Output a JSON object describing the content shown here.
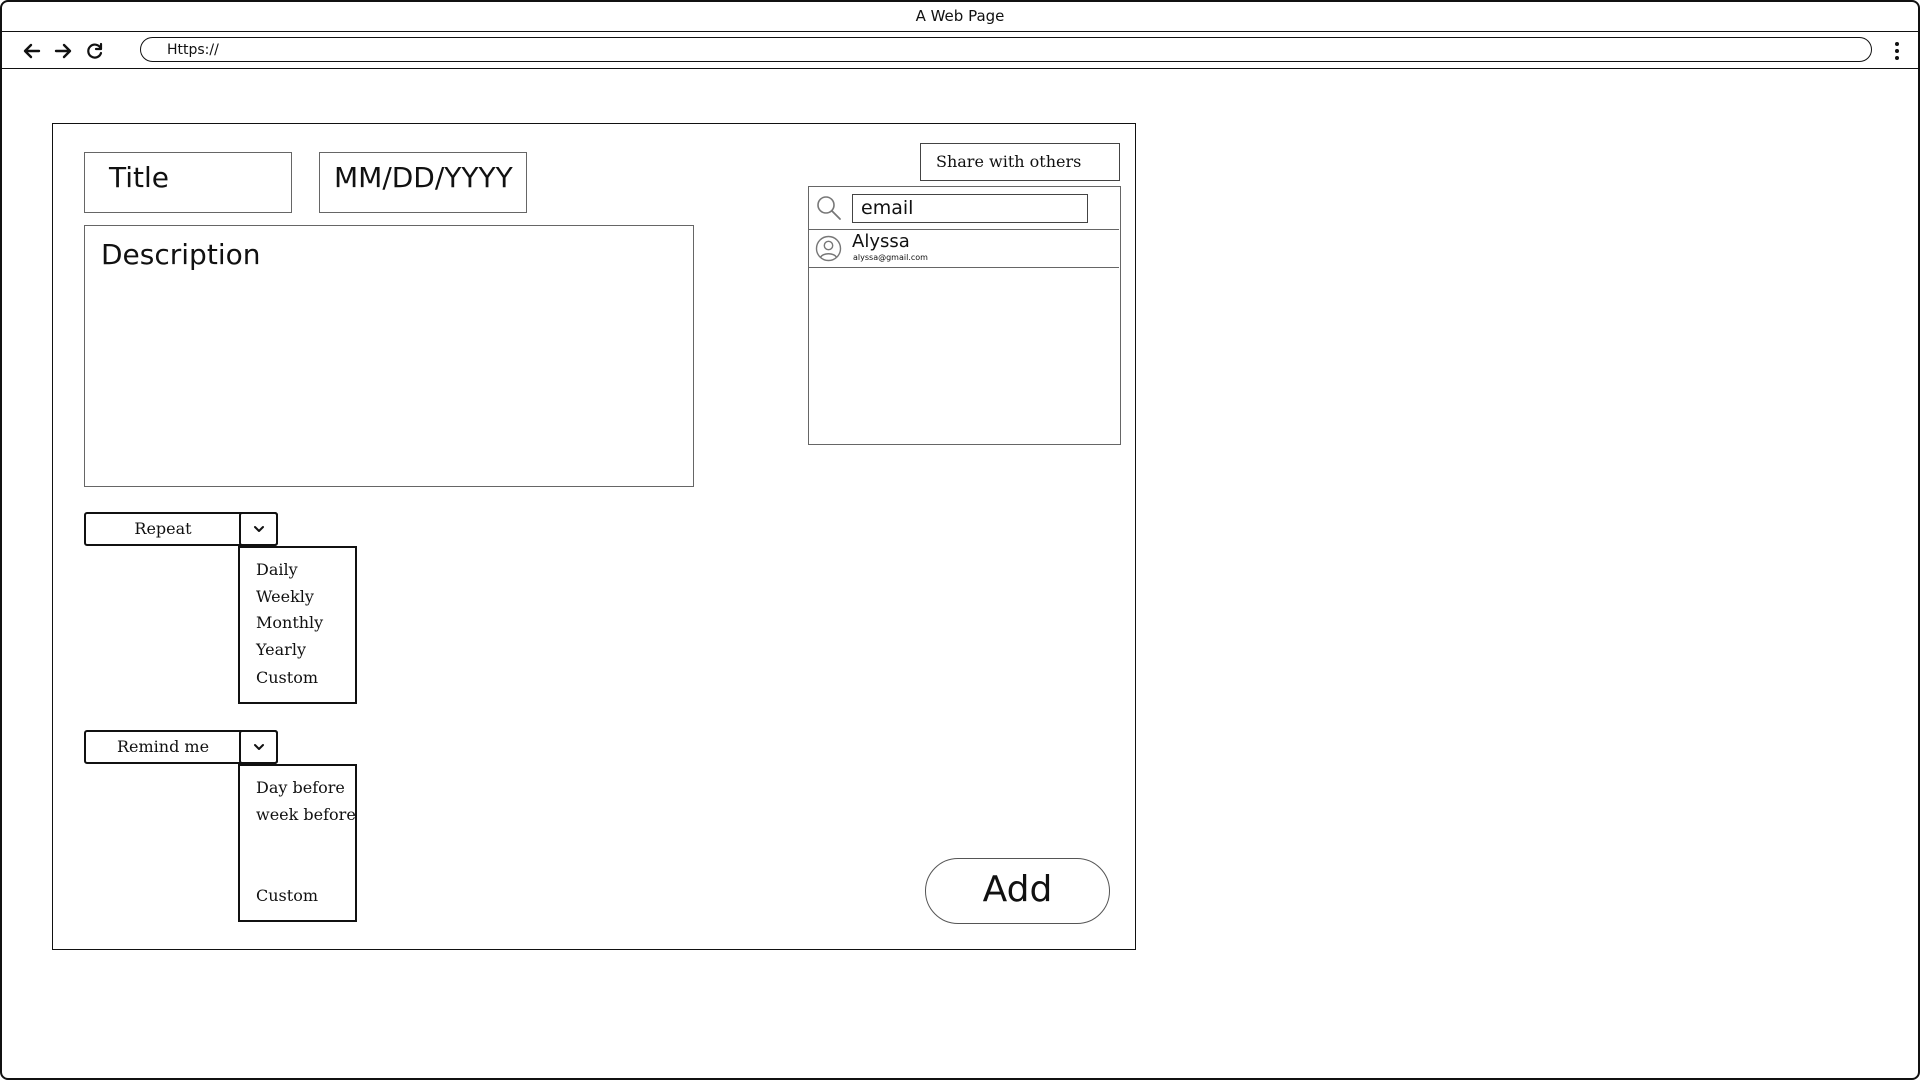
{
  "window": {
    "title": "A Web Page"
  },
  "toolbar": {
    "back_icon": "arrow-left-icon",
    "forward_icon": "arrow-right-icon",
    "reload_icon": "reload-icon",
    "address": "Https://",
    "menu_icon": "kebab-menu-icon"
  },
  "form": {
    "title_placeholder": "Title",
    "date_placeholder": "MM/DD/YYYY",
    "description_placeholder": "Description",
    "repeat": {
      "label": "Repeat",
      "options": [
        "Daily",
        "Weekly",
        "Monthly",
        "Yearly",
        "Custom"
      ]
    },
    "remind": {
      "label": "Remind me",
      "options": [
        "Day before",
        "week before",
        "Custom"
      ]
    },
    "add_label": "Add"
  },
  "share": {
    "button_label": "Share with others",
    "search_placeholder": "email",
    "users": [
      {
        "name": "Alyssa",
        "email": "alyssa@gmail.com"
      }
    ]
  }
}
